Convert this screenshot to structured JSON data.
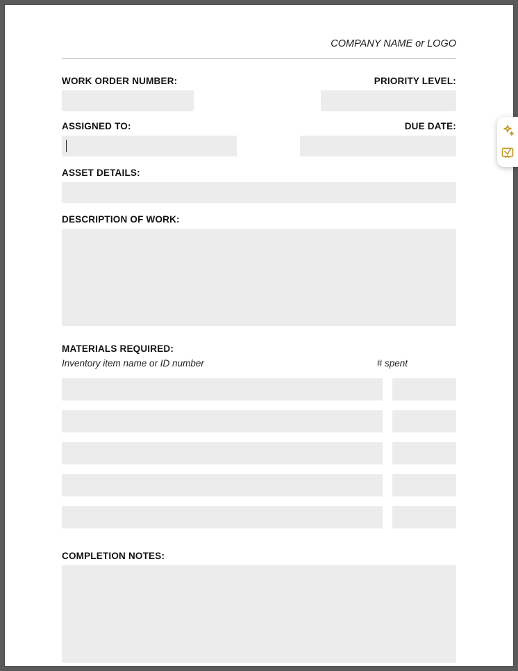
{
  "header": {
    "company_line": "COMPANY NAME or LOGO"
  },
  "fields": {
    "work_order_number": {
      "label": "WORK ORDER NUMBER:",
      "value": ""
    },
    "priority_level": {
      "label": "PRIORITY LEVEL:",
      "value": ""
    },
    "assigned_to": {
      "label": "ASSIGNED TO:",
      "value": ""
    },
    "due_date": {
      "label": "DUE DATE:",
      "value": ""
    },
    "asset_details": {
      "label": "ASSET DETAILS:",
      "value": ""
    },
    "description": {
      "label": "DESCRIPTION OF WORK:",
      "value": ""
    },
    "completion_notes": {
      "label": "COMPLETION NOTES:",
      "value": ""
    }
  },
  "materials": {
    "label": "MATERIALS REQUIRED:",
    "sub_name": "Inventory item name or ID number",
    "sub_spent": "# spent",
    "rows": [
      {
        "name": "",
        "spent": ""
      },
      {
        "name": "",
        "spent": ""
      },
      {
        "name": "",
        "spent": ""
      },
      {
        "name": "",
        "spent": ""
      },
      {
        "name": "",
        "spent": ""
      }
    ]
  },
  "toolbar": {
    "icon1": "sparkle-icon",
    "icon2": "annotate-icon"
  }
}
